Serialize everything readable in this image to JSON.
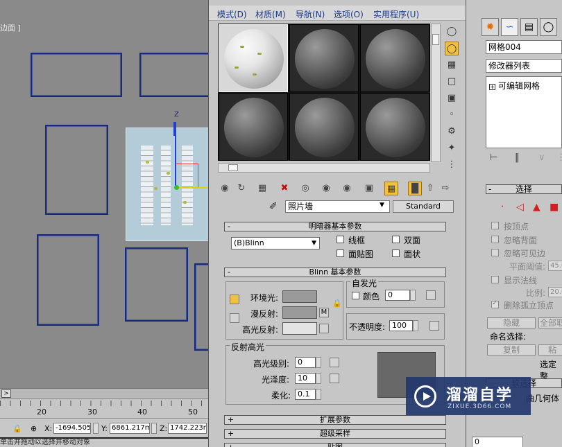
{
  "viewport": {
    "label": "边面 ]",
    "axis_z": "Z"
  },
  "timeline": {
    "arrow": ">",
    "ruler_numbers": [
      "20",
      "30",
      "40",
      "50"
    ]
  },
  "coords": {
    "x_label": "X:",
    "x_value": "-1694.505",
    "y_label": "Y:",
    "y_value": "6861.217m",
    "z_label": "Z:",
    "z_value": "1742.223m"
  },
  "status_text": "单击并拖动以选择并移动对象",
  "material_editor": {
    "menu": [
      "模式(D)",
      "材质(M)",
      "导航(N)",
      "选项(O)",
      "实用程序(U)"
    ],
    "material_name": "照片墙",
    "material_type": "Standard",
    "shader_rollout": {
      "title": "明暗器基本参数",
      "shader": "(B)Blinn",
      "wire": "线框",
      "two_sided": "双面",
      "face_map": "面贴图",
      "faceted": "面状"
    },
    "blinn_rollout": {
      "title": "Blinn 基本参数",
      "ambient": "环境光:",
      "diffuse": "漫反射:",
      "specular": "高光反射:",
      "map_btn": "M",
      "self_illum": {
        "title": "自发光",
        "color_label": "颜色",
        "value": "0"
      },
      "opacity_label": "不透明度:",
      "opacity_value": "100",
      "specular_highlights": {
        "title": "反射高光",
        "level_label": "高光级别:",
        "level_value": "0",
        "gloss_label": "光泽度:",
        "gloss_value": "10",
        "soften_label": "柔化:",
        "soften_value": "0.1"
      }
    },
    "collapsed_rollouts": [
      "扩展参数",
      "超级采样",
      "贴图"
    ]
  },
  "command_panel": {
    "object_name": "网格004",
    "modifier_list": "修改器列表",
    "stack_item": "可编辑网格",
    "selection_rollout": "选择",
    "checkboxes": [
      "按顶点",
      "忽略背面",
      "忽略可见边"
    ],
    "plane_threshold_label": "平面阈值:",
    "plane_threshold_value": "45.0",
    "show_normals": "显示法线",
    "scale_label": "比例:",
    "scale_value": "20.0",
    "delete_isolated": "删除孤立顶点",
    "hide_btn": "隐藏",
    "unhide_btn": "全部取",
    "named_sel_label": "命名选择:",
    "copy_btn": "复制",
    "paste_btn": "粘",
    "selected_all": "选定整",
    "soft_sel": "软选择",
    "surface": "曲几何体",
    "bottom_value": "0"
  },
  "watermark": {
    "title": "溜溜自学",
    "url": "ZIXUE.3D66.COM"
  }
}
